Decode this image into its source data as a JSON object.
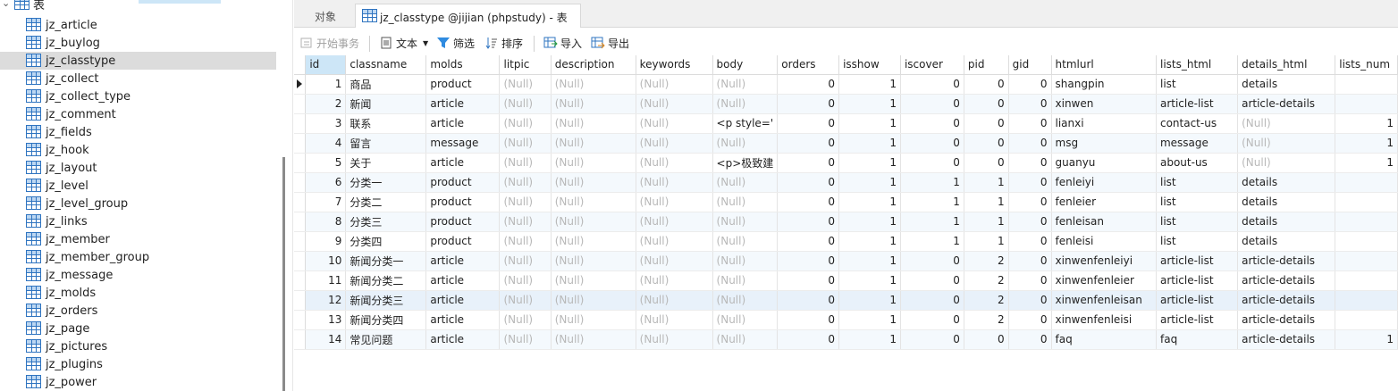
{
  "sidebar": {
    "root_label": "表",
    "items": [
      {
        "label": "jz_article"
      },
      {
        "label": "jz_buylog"
      },
      {
        "label": "jz_classtype",
        "selected": true
      },
      {
        "label": "jz_collect"
      },
      {
        "label": "jz_collect_type"
      },
      {
        "label": "jz_comment"
      },
      {
        "label": "jz_fields"
      },
      {
        "label": "jz_hook"
      },
      {
        "label": "jz_layout"
      },
      {
        "label": "jz_level"
      },
      {
        "label": "jz_level_group"
      },
      {
        "label": "jz_links"
      },
      {
        "label": "jz_member"
      },
      {
        "label": "jz_member_group"
      },
      {
        "label": "jz_message"
      },
      {
        "label": "jz_molds"
      },
      {
        "label": "jz_orders"
      },
      {
        "label": "jz_page"
      },
      {
        "label": "jz_pictures"
      },
      {
        "label": "jz_plugins"
      },
      {
        "label": "jz_power"
      }
    ]
  },
  "tabs": {
    "objects_label": "对象",
    "active_label": "jz_classtype @jijian (phpstudy) - 表"
  },
  "toolbar": {
    "begin_tx": "开始事务",
    "text": "文本",
    "filter": "筛选",
    "sort": "排序",
    "import": "导入",
    "export": "导出"
  },
  "grid": {
    "columns": [
      "id",
      "classname",
      "molds",
      "litpic",
      "description",
      "keywords",
      "body",
      "orders",
      "isshow",
      "iscover",
      "pid",
      "gid",
      "htmlurl",
      "lists_html",
      "details_html",
      "lists_num"
    ],
    "rows": [
      [
        "1",
        "商品",
        "product",
        "(Null)",
        "(Null)",
        "(Null)",
        "(Null)",
        "0",
        "1",
        "0",
        "0",
        "0",
        "shangpin",
        "list",
        "details",
        ""
      ],
      [
        "2",
        "新闻",
        "article",
        "(Null)",
        "(Null)",
        "(Null)",
        "(Null)",
        "0",
        "1",
        "0",
        "0",
        "0",
        "xinwen",
        "article-list",
        "article-details",
        ""
      ],
      [
        "3",
        "联系",
        "article",
        "(Null)",
        "(Null)",
        "(Null)",
        "<p style='",
        "0",
        "1",
        "0",
        "0",
        "0",
        "lianxi",
        "contact-us",
        "(Null)",
        "1"
      ],
      [
        "4",
        "留言",
        "message",
        "(Null)",
        "(Null)",
        "(Null)",
        "(Null)",
        "0",
        "1",
        "0",
        "0",
        "0",
        "msg",
        "message",
        "(Null)",
        "1"
      ],
      [
        "5",
        "关于",
        "article",
        "(Null)",
        "(Null)",
        "(Null)",
        "<p>极致建",
        "0",
        "1",
        "0",
        "0",
        "0",
        "guanyu",
        "about-us",
        "(Null)",
        "1"
      ],
      [
        "6",
        "分类一",
        "product",
        "(Null)",
        "(Null)",
        "(Null)",
        "(Null)",
        "0",
        "1",
        "1",
        "1",
        "0",
        "fenleiyi",
        "list",
        "details",
        ""
      ],
      [
        "7",
        "分类二",
        "product",
        "(Null)",
        "(Null)",
        "(Null)",
        "(Null)",
        "0",
        "1",
        "1",
        "1",
        "0",
        "fenleier",
        "list",
        "details",
        ""
      ],
      [
        "8",
        "分类三",
        "product",
        "(Null)",
        "(Null)",
        "(Null)",
        "(Null)",
        "0",
        "1",
        "1",
        "1",
        "0",
        "fenleisan",
        "list",
        "details",
        ""
      ],
      [
        "9",
        "分类四",
        "product",
        "(Null)",
        "(Null)",
        "(Null)",
        "(Null)",
        "0",
        "1",
        "1",
        "1",
        "0",
        "fenleisi",
        "list",
        "details",
        ""
      ],
      [
        "10",
        "新闻分类一",
        "article",
        "(Null)",
        "(Null)",
        "(Null)",
        "(Null)",
        "0",
        "1",
        "0",
        "2",
        "0",
        "xinwenfenleiyi",
        "article-list",
        "article-details",
        ""
      ],
      [
        "11",
        "新闻分类二",
        "article",
        "(Null)",
        "(Null)",
        "(Null)",
        "(Null)",
        "0",
        "1",
        "0",
        "2",
        "0",
        "xinwenfenleier",
        "article-list",
        "article-details",
        ""
      ],
      [
        "12",
        "新闻分类三",
        "article",
        "(Null)",
        "(Null)",
        "(Null)",
        "(Null)",
        "0",
        "1",
        "0",
        "2",
        "0",
        "xinwenfenleisan",
        "article-list",
        "article-details",
        ""
      ],
      [
        "13",
        "新闻分类四",
        "article",
        "(Null)",
        "(Null)",
        "(Null)",
        "(Null)",
        "0",
        "1",
        "0",
        "2",
        "0",
        "xinwenfenleisi",
        "article-list",
        "article-details",
        ""
      ],
      [
        "14",
        "常见问题",
        "article",
        "(Null)",
        "(Null)",
        "(Null)",
        "(Null)",
        "0",
        "1",
        "0",
        "0",
        "0",
        "faq",
        "faq",
        "article-details",
        "1"
      ]
    ]
  },
  "colors": {
    "accent": "#2f74c0",
    "selection": "#cde6f7",
    "null_text": "#b8b8b8"
  }
}
